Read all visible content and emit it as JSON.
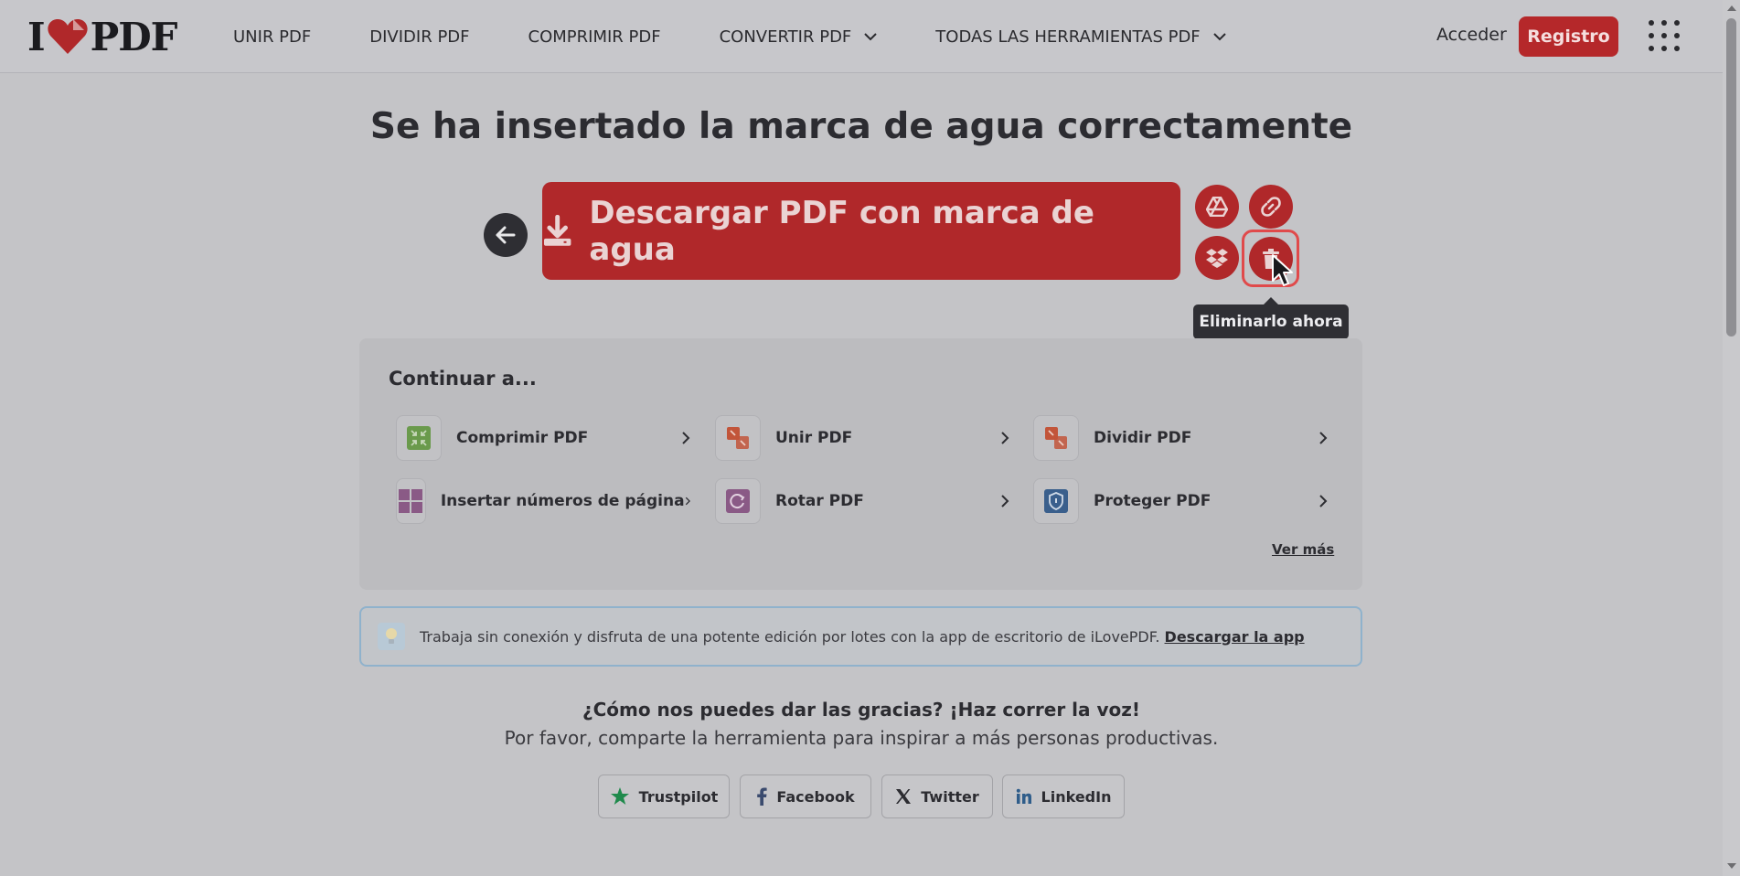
{
  "header": {
    "logo_left": "I",
    "logo_right": "PDF",
    "nav": [
      {
        "label": "UNIR PDF"
      },
      {
        "label": "DIVIDIR PDF"
      },
      {
        "label": "COMPRIMIR PDF"
      },
      {
        "label": "CONVERTIR PDF"
      },
      {
        "label": "TODAS LAS HERRAMIENTAS PDF"
      }
    ],
    "login": "Acceder",
    "register": "Registro"
  },
  "main": {
    "title": "Se ha insertado la marca de agua correctamente",
    "download_label": "Descargar PDF con marca de agua",
    "tooltip": "Eliminarlo ahora"
  },
  "continue": {
    "title": "Continuar a...",
    "tools": [
      {
        "label": "Comprimir PDF",
        "icon": "compress-icon",
        "color": "#6a9a4c"
      },
      {
        "label": "Unir PDF",
        "icon": "merge-icon",
        "color": "#c2553a"
      },
      {
        "label": "Dividir PDF",
        "icon": "split-icon",
        "color": "#c2553a"
      },
      {
        "label": "Insertar números de página",
        "icon": "page-numbers-icon",
        "color": "#8a5a86"
      },
      {
        "label": "Rotar PDF",
        "icon": "rotate-icon",
        "color": "#8a5a86"
      },
      {
        "label": "Proteger PDF",
        "icon": "shield-icon",
        "color": "#3a5f8c"
      }
    ],
    "more": "Ver más"
  },
  "banner": {
    "text": "Trabaja sin conexión y disfruta de una potente edición por lotes con la app de escritorio de iLovePDF.",
    "link": "Descargar la app"
  },
  "share": {
    "thanks": "¿Cómo nos puedes dar las gracias? ¡Haz correr la voz!",
    "subtitle": "Por favor, comparte la herramienta para inspirar a más personas productivas.",
    "buttons": [
      {
        "label": "Trustpilot"
      },
      {
        "label": "Facebook"
      },
      {
        "label": "Twitter"
      },
      {
        "label": "LinkedIn"
      }
    ]
  },
  "colors": {
    "brand_red": "#b0282a",
    "tooltip_bg": "#2f2f34",
    "banner_border": "#8fb2cc"
  }
}
